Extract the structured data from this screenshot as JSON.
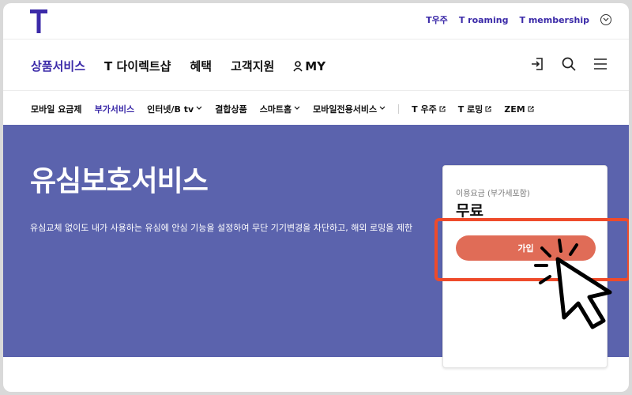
{
  "utility": {
    "items": [
      {
        "label": "T우주"
      },
      {
        "label": "T roaming"
      },
      {
        "label": "T membership"
      }
    ]
  },
  "main_nav": {
    "items": [
      {
        "label": "상품서비스",
        "active": true
      },
      {
        "label": "T 다이렉트샵"
      },
      {
        "label": "혜택"
      },
      {
        "label": "고객지원"
      },
      {
        "label": "MY"
      }
    ]
  },
  "sub_nav": {
    "items": [
      {
        "label": "모바일 요금제"
      },
      {
        "label": "부가서비스",
        "active": true
      },
      {
        "label": "인터넷/B tv"
      },
      {
        "label": "결합상품"
      },
      {
        "label": "스마트홈"
      },
      {
        "label": "모바일전용서비스"
      },
      {
        "label": "T 우주"
      },
      {
        "label": "T 로밍"
      },
      {
        "label": "ZEM"
      }
    ]
  },
  "hero": {
    "title": "유심보호서비스",
    "description": "유심교체 없이도 내가 사용하는 유심에 안심 기능을 설정하여 무단 기기변경을 차단하고, 해외 로밍을 제한"
  },
  "card": {
    "fee_label": "이용요금 (부가세포함)",
    "fee_value": "무료",
    "join_label": "가입"
  },
  "colors": {
    "brand": "#3b2aa8",
    "hero_bg": "#5b63ad",
    "join_button": "#e06c57",
    "highlight": "#ee4b2b"
  }
}
